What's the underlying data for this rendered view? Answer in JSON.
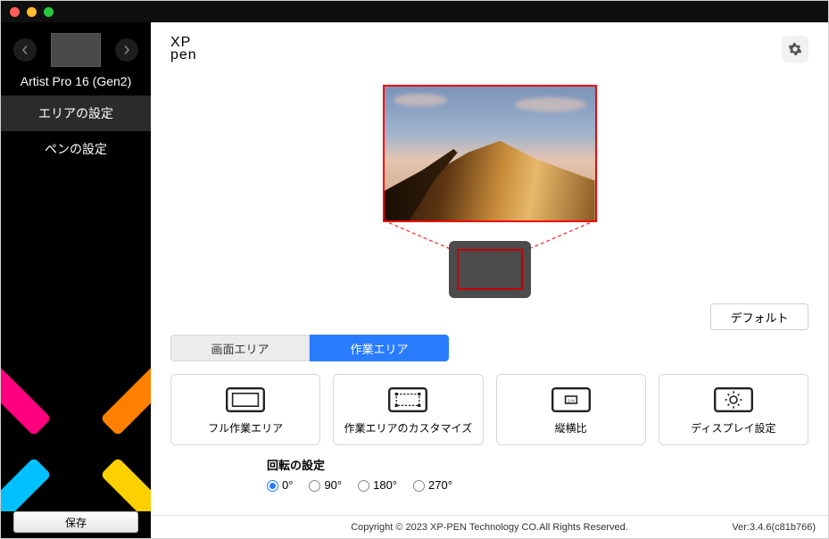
{
  "sidebar": {
    "device_name": "Artist Pro 16 (Gen2)",
    "items": [
      {
        "label": "エリアの設定",
        "active": true
      },
      {
        "label": "ペンの設定",
        "active": false
      }
    ],
    "save_label": "保存"
  },
  "logo_line1": "XP",
  "logo_line2": "pen",
  "default_button": "デフォルト",
  "tabs": {
    "screen_area": "画面エリア",
    "work_area": "作業エリア"
  },
  "cards": {
    "full": "フル作業エリア",
    "custom": "作業エリアのカスタマイズ",
    "ratio": "縦横比",
    "display": "ディスプレイ設定"
  },
  "rotation": {
    "title": "回転の設定",
    "options": [
      "0°",
      "90°",
      "180°",
      "270°"
    ],
    "selected": 0
  },
  "footer": {
    "copyright": "Copyright © 2023  XP-PEN Technology CO.All Rights Reserved.",
    "version": "Ver:3.4.6(c81b766)"
  }
}
